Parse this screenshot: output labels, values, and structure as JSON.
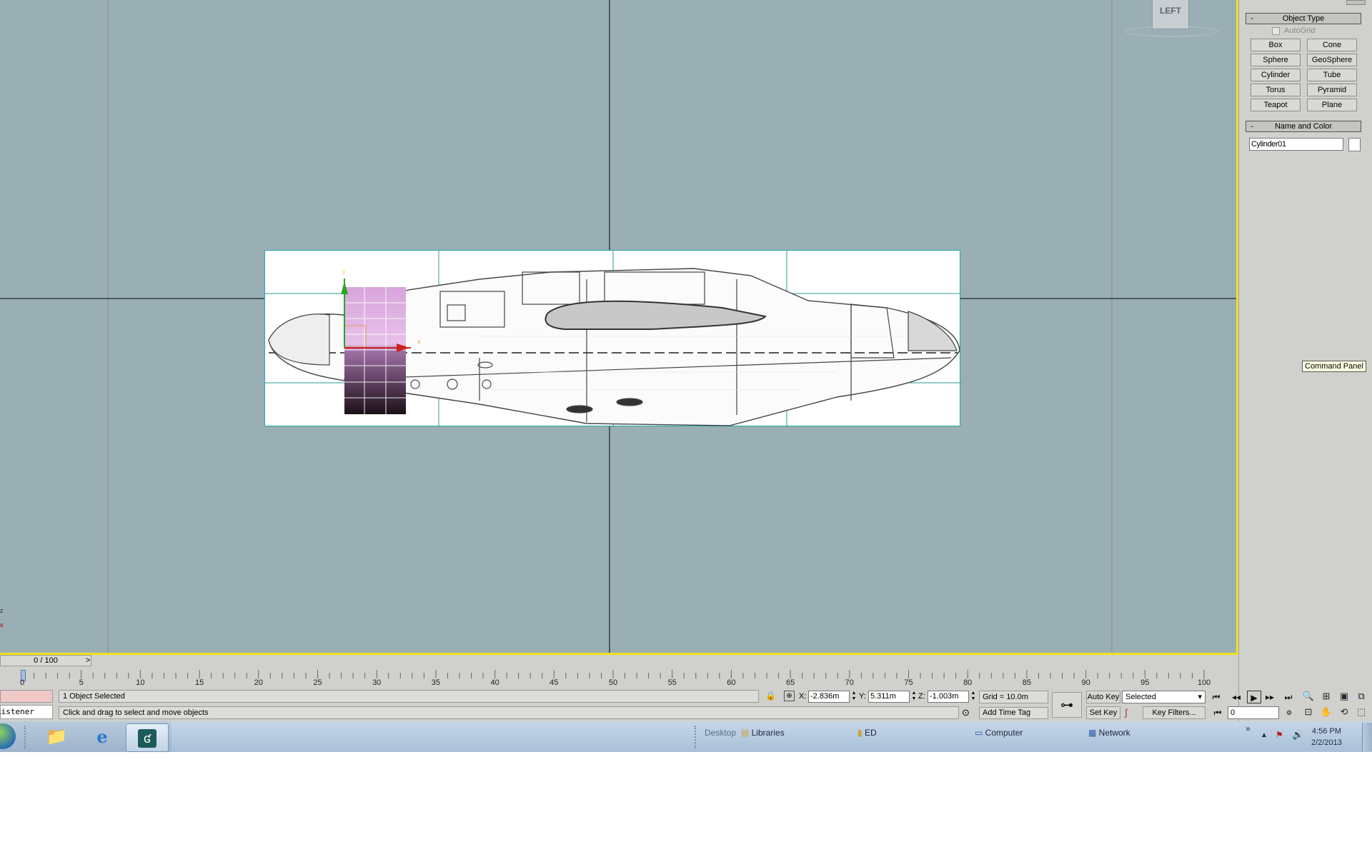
{
  "viewport": {
    "view_label": "LEFT",
    "axis_z": "z",
    "axis_x": "x",
    "gizmo_y": "y",
    "gizmo_x": "x"
  },
  "command_panel": {
    "object_type_title": "Object Type",
    "autogrid_label": "AutoGrid",
    "buttons": [
      "Box",
      "Cone",
      "Sphere",
      "GeoSphere",
      "Cylinder",
      "Tube",
      "Torus",
      "Pyramid",
      "Teapot",
      "Plane"
    ],
    "name_color_title": "Name and Color",
    "object_name": "Cylinder01",
    "object_color": "#ffffff",
    "tooltip": "Command Panel"
  },
  "timeline": {
    "slider_text": "0 / 100",
    "next_arrow": ">",
    "ticks": [
      "0",
      "5",
      "10",
      "15",
      "20",
      "25",
      "30",
      "35",
      "40",
      "45",
      "50",
      "55",
      "60",
      "65",
      "70",
      "75",
      "80",
      "85",
      "90",
      "95",
      "100"
    ]
  },
  "status": {
    "listener": "Listener",
    "selection": "1 Object Selected",
    "prompt": "Click and drag to select and move objects",
    "x_label": "X:",
    "x_value": "-2.836m",
    "y_label": "Y:",
    "y_value": "5.311m",
    "z_label": "Z:",
    "z_value": "-1.003m",
    "grid": "Grid = 10.0m",
    "add_time_tag": "Add Time Tag"
  },
  "animation": {
    "auto_key": "Auto Key",
    "set_key": "Set Key",
    "selected": "Selected",
    "key_filters": "Key Filters...",
    "frame": "0"
  },
  "taskbar": {
    "desktop": "Desktop",
    "libraries": "Libraries",
    "ed": "ED",
    "computer": "Computer",
    "network": "Network",
    "overflow": "»",
    "time": "4:56 PM",
    "date": "2/2/2013"
  }
}
